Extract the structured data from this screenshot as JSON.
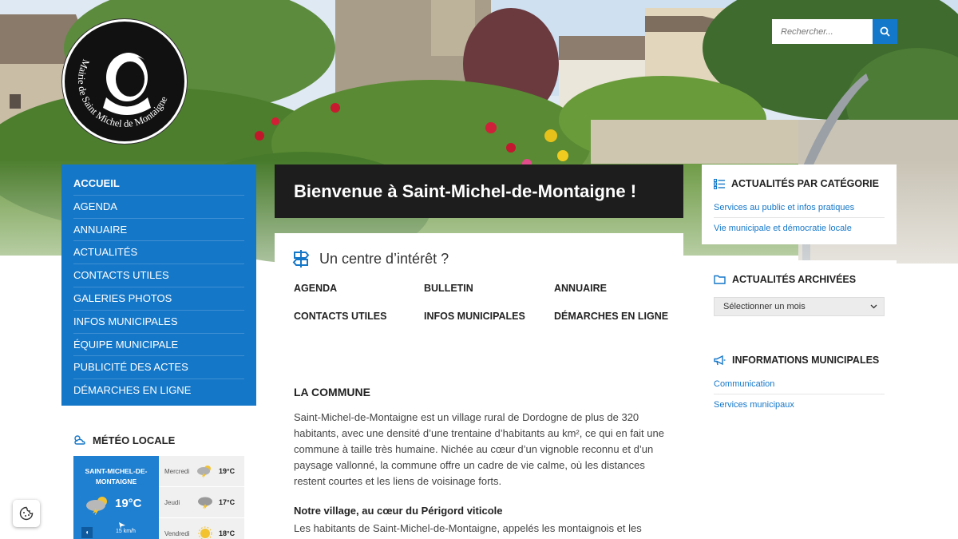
{
  "site": {
    "logo_text": "Mairie de Saint Michel de Montaigne"
  },
  "search": {
    "placeholder": "Rechercher..."
  },
  "nav": {
    "items": [
      {
        "label": "ACCUEIL"
      },
      {
        "label": "AGENDA"
      },
      {
        "label": "ANNUAIRE"
      },
      {
        "label": "ACTUALITÉS"
      },
      {
        "label": "CONTACTS UTILES"
      },
      {
        "label": "GALERIES PHOTOS"
      },
      {
        "label": "INFOS MUNICIPALES"
      },
      {
        "label": "ÉQUIPE MUNICIPALE"
      },
      {
        "label": "PUBLICITÉ DES ACTES"
      },
      {
        "label": "DÉMARCHES EN LIGNE"
      }
    ]
  },
  "meteo": {
    "title": "MÉTÉO LOCALE",
    "city": "SAINT-MICHEL-DE-MONTAIGNE",
    "temp": "19°C",
    "wind": "15 km/h",
    "days": [
      {
        "name": "Mercredi",
        "temp": "19°C",
        "icon": "storm-sun-icon"
      },
      {
        "name": "Jeudi",
        "temp": "17°C",
        "icon": "storm-icon"
      },
      {
        "name": "Vendredi",
        "temp": "18°C",
        "icon": "sun-icon"
      }
    ]
  },
  "main": {
    "welcome": "Bienvenue à Saint-Michel-de-Montaigne !",
    "poi_title": "Un centre d’intérêt ?",
    "poi_links": [
      "AGENDA",
      "BULLETIN",
      "ANNUAIRE",
      "CONTACTS UTILES",
      "INFOS MUNICIPALES",
      "DÉMARCHES EN LIGNE"
    ],
    "commune_title": "LA COMMUNE",
    "commune_text": "Saint-Michel-de-Montaigne est un village rural de Dordogne de plus de 320 habitants, avec une densité d’une trentaine d’habitants au km², ce qui en fait une commune à taille très humaine. Nichée au cœur d’un vignoble reconnu et d’un paysage vallonné, la commune offre un cadre de vie calme, où les distances restent courtes et les liens de voisinage forts.",
    "village_title": "Notre village, au cœur du Périgord viticole",
    "village_text": "Les habitants de Saint-Michel-de-Montaigne, appelés les montaignois et les"
  },
  "sidebar": {
    "categories": {
      "title": "ACTUALITÉS PAR CATÉGORIE",
      "links": [
        "Services au public et infos pratiques",
        "Vie municipale et démocratie locale"
      ]
    },
    "archives": {
      "title": "ACTUALITÉS ARCHIVÉES",
      "select_value": "Sélectionner un mois"
    },
    "infos": {
      "title": "INFORMATIONS MUNICIPALES",
      "links": [
        "Communication",
        "Services municipaux"
      ]
    }
  },
  "colors": {
    "accent": "#1577c8",
    "dark": "#1d1d1d"
  }
}
